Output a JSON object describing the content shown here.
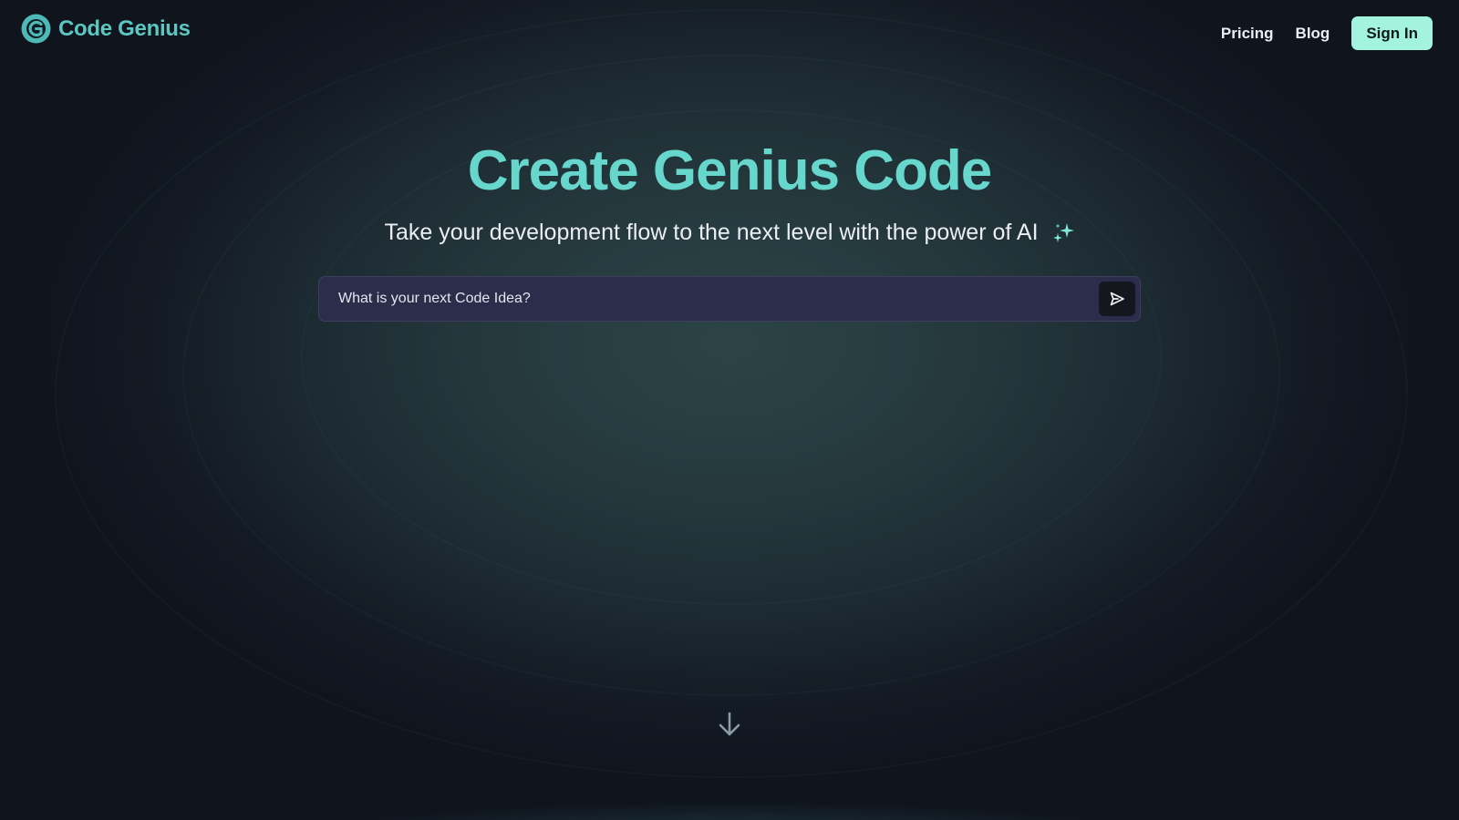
{
  "header": {
    "brand_name": "Code Genius",
    "nav": [
      {
        "label": "Pricing"
      },
      {
        "label": "Blog"
      }
    ],
    "sign_in_label": "Sign In"
  },
  "hero": {
    "title": "Create Genius Code",
    "subtitle": "Take your development flow to the next level with the power of AI",
    "subtitle_icon": "sparkles-icon"
  },
  "prompt": {
    "placeholder": "What is your next Code Idea?",
    "value": "",
    "send_icon": "send-icon"
  },
  "scroll": {
    "icon": "arrow-down-icon"
  },
  "colors": {
    "brand": "#5cc6c0",
    "title": "#67d6cd",
    "accent_button": "#a4f3df",
    "input_background": "#2c2c4b",
    "page_background": "#0f141d"
  }
}
